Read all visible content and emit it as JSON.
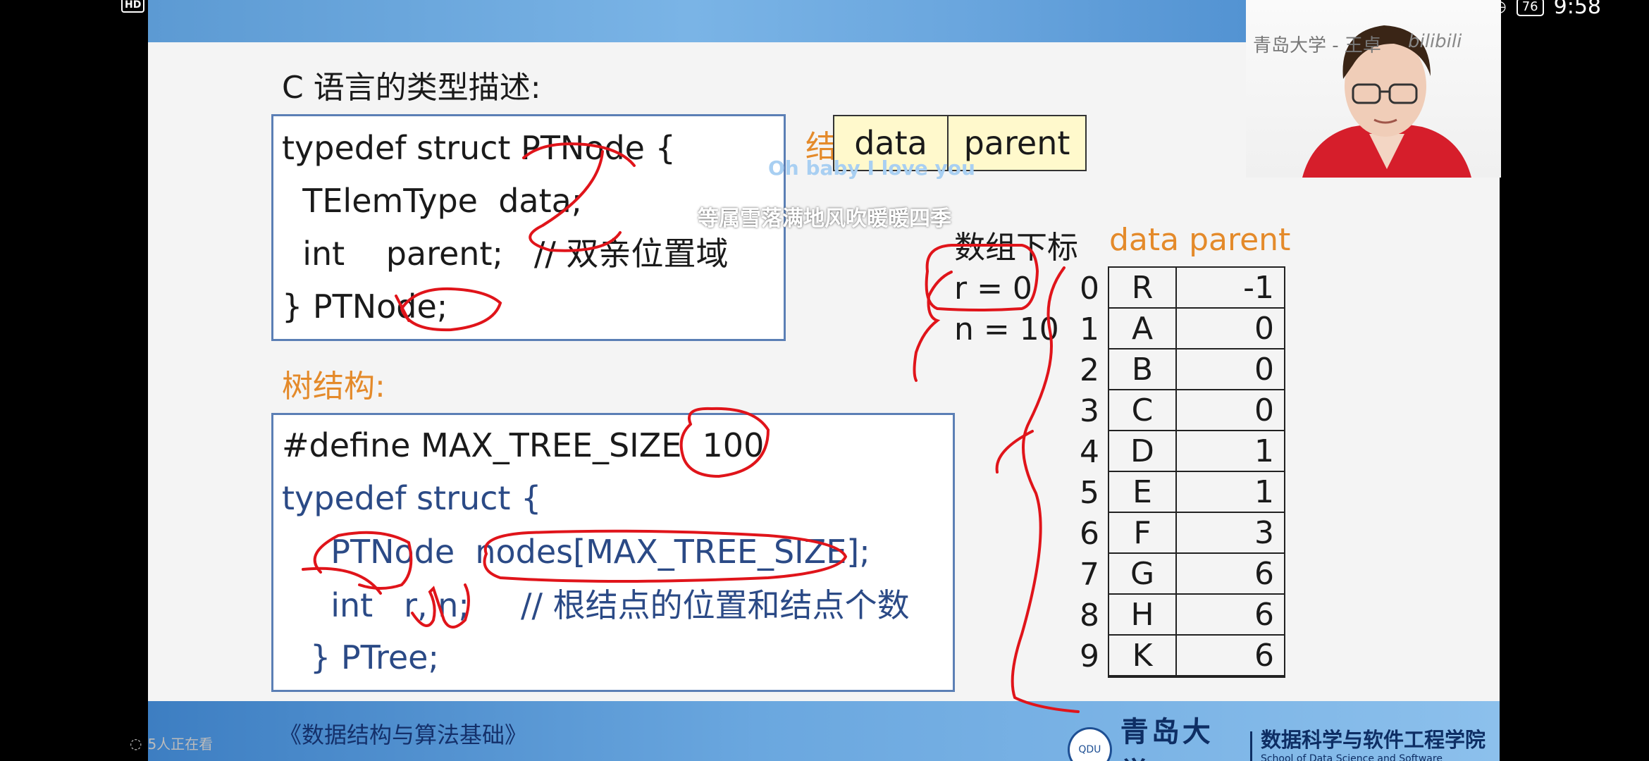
{
  "status_bar": {
    "hd_badge": "HD",
    "battery": "76",
    "time": "9:58"
  },
  "slide": {
    "heading": "C 语言的类型描述:",
    "node_code": [
      "typedef struct PTNode {",
      "  TElemType  data;",
      "  int    parent;   // 双亲位置域",
      "} PTNode;"
    ],
    "node_struct_label": "结点结构:",
    "node_struct_fields": [
      "data",
      "parent"
    ],
    "tree_label": "树结构:",
    "tree_code": {
      "define_line": "#define MAX_TREE_SIZE  100",
      "typedef_line": "typedef struct {",
      "nodes_line": "  PTNode  nodes[MAX_TREE_SIZE];",
      "int_line": "  int   r, n;     // 根结点的位置和结点个数",
      "end_line": "} PTree;"
    },
    "array_header": {
      "index_label": "数组下标",
      "cols": "data parent"
    },
    "r_label": "r = 0",
    "n_label": "n = 10",
    "array_rows": [
      {
        "index": "0",
        "data": "R",
        "parent": "-1"
      },
      {
        "index": "1",
        "data": "A",
        "parent": "0"
      },
      {
        "index": "2",
        "data": "B",
        "parent": "0"
      },
      {
        "index": "3",
        "data": "C",
        "parent": "0"
      },
      {
        "index": "4",
        "data": "D",
        "parent": "1"
      },
      {
        "index": "5",
        "data": "E",
        "parent": "1"
      },
      {
        "index": "6",
        "data": "F",
        "parent": "3"
      },
      {
        "index": "7",
        "data": "G",
        "parent": "6"
      },
      {
        "index": "8",
        "data": "H",
        "parent": "6"
      },
      {
        "index": "9",
        "data": "K",
        "parent": "6"
      }
    ],
    "footer_book": "《数据结构与算法基础》",
    "footer_uni": "青岛大学",
    "footer_school_cn": "数据科学与软件工程学院",
    "footer_school_en": "School of Data Science and Software Engineering",
    "footer_seal_text": "QDU"
  },
  "overlays": {
    "danmaku_1": "Oh baby I love you",
    "danmaku_2": "等属雪落满地风吹暖暖四季"
  },
  "webcam": {
    "title": "青岛大学 - 王卓",
    "logo": "bilibili"
  },
  "viewers": "5人正在看",
  "colors": {
    "accent_orange": "#e48a2a",
    "ink_red": "#e0141a",
    "topbar_blue": "#5c9ad3",
    "code_blue": "#2b4a86"
  }
}
